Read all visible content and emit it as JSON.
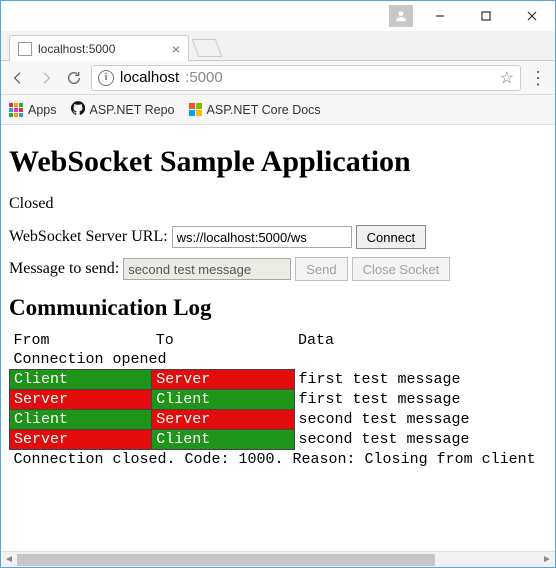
{
  "window": {
    "minimize": "–",
    "maximize": "□",
    "close": "×"
  },
  "browser": {
    "tab_title": "localhost:5000",
    "url_host": "localhost",
    "url_rest": ":5000",
    "bookmarks": {
      "apps": "Apps",
      "repo": "ASP.NET Repo",
      "docs": "ASP.NET Core Docs"
    }
  },
  "page": {
    "heading": "WebSocket Sample Application",
    "status": "Closed",
    "url_label": "WebSocket Server URL:",
    "url_value": "ws://localhost:5000/ws",
    "connect_btn": "Connect",
    "msg_label": "Message to send:",
    "msg_value": "second test message",
    "send_btn": "Send",
    "close_btn": "Close Socket",
    "log_heading": "Communication Log",
    "log_headers": {
      "from": "From",
      "to": "To",
      "data": "Data"
    },
    "log_open": "Connection opened",
    "log_rows": [
      {
        "from": "Client",
        "from_cls": "client",
        "to": "Server",
        "to_cls": "server",
        "data": "first test message"
      },
      {
        "from": "Server",
        "from_cls": "server",
        "to": "Client",
        "to_cls": "client",
        "data": "first test message"
      },
      {
        "from": "Client",
        "from_cls": "client",
        "to": "Server",
        "to_cls": "server",
        "data": "second test message"
      },
      {
        "from": "Server",
        "from_cls": "server",
        "to": "Client",
        "to_cls": "client",
        "data": "second test message"
      }
    ],
    "log_close": "Connection closed. Code: 1000. Reason: Closing from client"
  }
}
